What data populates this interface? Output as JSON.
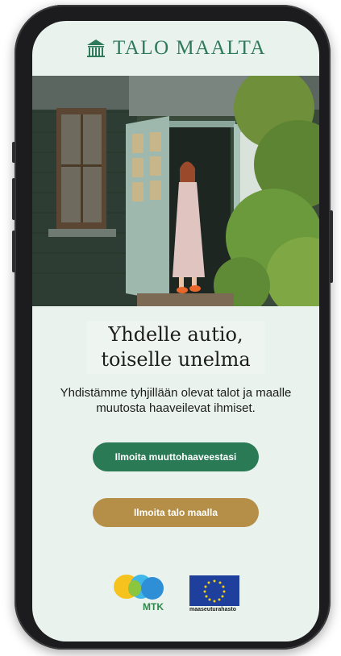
{
  "brand": {
    "name": "TALO MAALTA",
    "icon": "house-columns-icon",
    "color": "#2f7a5a"
  },
  "hero": {
    "image": "woman-in-doorway-of-old-wooden-house"
  },
  "headline": {
    "line1": "Yhdelle autio,",
    "line2": "toiselle unelma"
  },
  "subtext": "Yhdistämme tyhjillään olevat talot ja maalle muutosta haaveilevat ihmiset.",
  "buttons": {
    "primary": {
      "label": "Ilmoita muuttohaaveestasi",
      "color": "#2a7a55"
    },
    "secondary": {
      "label": "Ilmoita talo maalla",
      "color": "#b58f47"
    }
  },
  "partners": {
    "mtk": {
      "label": "MTK"
    },
    "eu": {
      "label": "maaseuturahasto"
    }
  }
}
